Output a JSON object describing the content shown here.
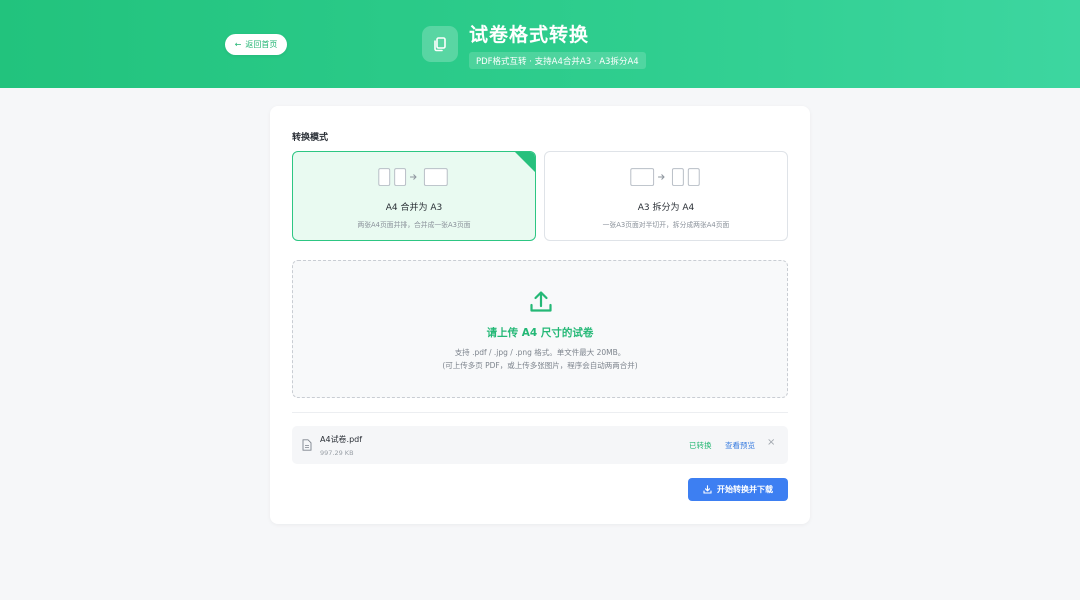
{
  "header": {
    "back_label": "返回首页",
    "title": "试卷格式转换",
    "subtitle": "PDF格式互转 · 支持A4合并A3 · A3拆分A4"
  },
  "section": {
    "label": "转换模式"
  },
  "modes": [
    {
      "title": "A4 合并为 A3",
      "desc": "两张A4页面并排，合并成一张A3页面",
      "selected": true
    },
    {
      "title": "A3 拆分为 A4",
      "desc": "一张A3页面对半切开，拆分成两张A4页面",
      "selected": false
    }
  ],
  "upload": {
    "title": "请上传 A4 尺寸的试卷",
    "line1": "支持 .pdf / .jpg / .png 格式。单文件最大 20MB。",
    "line2": "(可上传多页 PDF，或上传多张图片，程序会自动两两合并)"
  },
  "files": [
    {
      "name": "A4试卷.pdf",
      "size": "997.29 KB",
      "status": "已转换",
      "preview_label": "查看预览",
      "close": "×"
    }
  ],
  "actions": {
    "start_label": "开始转换并下载"
  },
  "colors": {
    "primary_green": "#2dc683",
    "blue": "#3d7ff2"
  },
  "icons": [
    "arrow-left-icon",
    "copy-document-icon",
    "upload-icon",
    "file-icon",
    "download-icon",
    "close-icon"
  ]
}
